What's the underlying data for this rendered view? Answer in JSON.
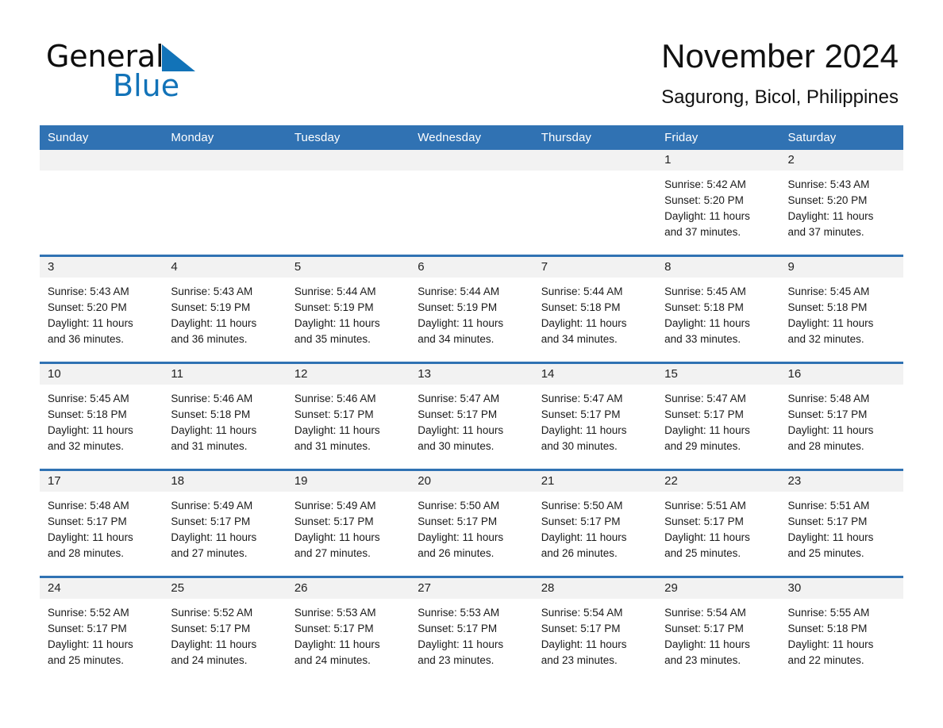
{
  "brand": {
    "name_part1": "General",
    "name_part2": "Blue",
    "accent_color": "#1273b8"
  },
  "header": {
    "title": "November 2024",
    "location": "Sagurong, Bicol, Philippines",
    "header_bg": "#3072b3",
    "daynum_bg": "#f2f2f2"
  },
  "weekdays": [
    "Sunday",
    "Monday",
    "Tuesday",
    "Wednesday",
    "Thursday",
    "Friday",
    "Saturday"
  ],
  "labels": {
    "sunrise": "Sunrise:",
    "sunset": "Sunset:",
    "daylight": "Daylight:"
  },
  "weeks": [
    [
      {
        "day": "",
        "empty": true
      },
      {
        "day": "",
        "empty": true
      },
      {
        "day": "",
        "empty": true
      },
      {
        "day": "",
        "empty": true
      },
      {
        "day": "",
        "empty": true
      },
      {
        "day": "1",
        "sunrise": "Sunrise: 5:42 AM",
        "sunset": "Sunset: 5:20 PM",
        "daylight_line1": "Daylight: 11 hours",
        "daylight_line2": "and 37 minutes."
      },
      {
        "day": "2",
        "sunrise": "Sunrise: 5:43 AM",
        "sunset": "Sunset: 5:20 PM",
        "daylight_line1": "Daylight: 11 hours",
        "daylight_line2": "and 37 minutes."
      }
    ],
    [
      {
        "day": "3",
        "sunrise": "Sunrise: 5:43 AM",
        "sunset": "Sunset: 5:20 PM",
        "daylight_line1": "Daylight: 11 hours",
        "daylight_line2": "and 36 minutes."
      },
      {
        "day": "4",
        "sunrise": "Sunrise: 5:43 AM",
        "sunset": "Sunset: 5:19 PM",
        "daylight_line1": "Daylight: 11 hours",
        "daylight_line2": "and 36 minutes."
      },
      {
        "day": "5",
        "sunrise": "Sunrise: 5:44 AM",
        "sunset": "Sunset: 5:19 PM",
        "daylight_line1": "Daylight: 11 hours",
        "daylight_line2": "and 35 minutes."
      },
      {
        "day": "6",
        "sunrise": "Sunrise: 5:44 AM",
        "sunset": "Sunset: 5:19 PM",
        "daylight_line1": "Daylight: 11 hours",
        "daylight_line2": "and 34 minutes."
      },
      {
        "day": "7",
        "sunrise": "Sunrise: 5:44 AM",
        "sunset": "Sunset: 5:18 PM",
        "daylight_line1": "Daylight: 11 hours",
        "daylight_line2": "and 34 minutes."
      },
      {
        "day": "8",
        "sunrise": "Sunrise: 5:45 AM",
        "sunset": "Sunset: 5:18 PM",
        "daylight_line1": "Daylight: 11 hours",
        "daylight_line2": "and 33 minutes."
      },
      {
        "day": "9",
        "sunrise": "Sunrise: 5:45 AM",
        "sunset": "Sunset: 5:18 PM",
        "daylight_line1": "Daylight: 11 hours",
        "daylight_line2": "and 32 minutes."
      }
    ],
    [
      {
        "day": "10",
        "sunrise": "Sunrise: 5:45 AM",
        "sunset": "Sunset: 5:18 PM",
        "daylight_line1": "Daylight: 11 hours",
        "daylight_line2": "and 32 minutes."
      },
      {
        "day": "11",
        "sunrise": "Sunrise: 5:46 AM",
        "sunset": "Sunset: 5:18 PM",
        "daylight_line1": "Daylight: 11 hours",
        "daylight_line2": "and 31 minutes."
      },
      {
        "day": "12",
        "sunrise": "Sunrise: 5:46 AM",
        "sunset": "Sunset: 5:17 PM",
        "daylight_line1": "Daylight: 11 hours",
        "daylight_line2": "and 31 minutes."
      },
      {
        "day": "13",
        "sunrise": "Sunrise: 5:47 AM",
        "sunset": "Sunset: 5:17 PM",
        "daylight_line1": "Daylight: 11 hours",
        "daylight_line2": "and 30 minutes."
      },
      {
        "day": "14",
        "sunrise": "Sunrise: 5:47 AM",
        "sunset": "Sunset: 5:17 PM",
        "daylight_line1": "Daylight: 11 hours",
        "daylight_line2": "and 30 minutes."
      },
      {
        "day": "15",
        "sunrise": "Sunrise: 5:47 AM",
        "sunset": "Sunset: 5:17 PM",
        "daylight_line1": "Daylight: 11 hours",
        "daylight_line2": "and 29 minutes."
      },
      {
        "day": "16",
        "sunrise": "Sunrise: 5:48 AM",
        "sunset": "Sunset: 5:17 PM",
        "daylight_line1": "Daylight: 11 hours",
        "daylight_line2": "and 28 minutes."
      }
    ],
    [
      {
        "day": "17",
        "sunrise": "Sunrise: 5:48 AM",
        "sunset": "Sunset: 5:17 PM",
        "daylight_line1": "Daylight: 11 hours",
        "daylight_line2": "and 28 minutes."
      },
      {
        "day": "18",
        "sunrise": "Sunrise: 5:49 AM",
        "sunset": "Sunset: 5:17 PM",
        "daylight_line1": "Daylight: 11 hours",
        "daylight_line2": "and 27 minutes."
      },
      {
        "day": "19",
        "sunrise": "Sunrise: 5:49 AM",
        "sunset": "Sunset: 5:17 PM",
        "daylight_line1": "Daylight: 11 hours",
        "daylight_line2": "and 27 minutes."
      },
      {
        "day": "20",
        "sunrise": "Sunrise: 5:50 AM",
        "sunset": "Sunset: 5:17 PM",
        "daylight_line1": "Daylight: 11 hours",
        "daylight_line2": "and 26 minutes."
      },
      {
        "day": "21",
        "sunrise": "Sunrise: 5:50 AM",
        "sunset": "Sunset: 5:17 PM",
        "daylight_line1": "Daylight: 11 hours",
        "daylight_line2": "and 26 minutes."
      },
      {
        "day": "22",
        "sunrise": "Sunrise: 5:51 AM",
        "sunset": "Sunset: 5:17 PM",
        "daylight_line1": "Daylight: 11 hours",
        "daylight_line2": "and 25 minutes."
      },
      {
        "day": "23",
        "sunrise": "Sunrise: 5:51 AM",
        "sunset": "Sunset: 5:17 PM",
        "daylight_line1": "Daylight: 11 hours",
        "daylight_line2": "and 25 minutes."
      }
    ],
    [
      {
        "day": "24",
        "sunrise": "Sunrise: 5:52 AM",
        "sunset": "Sunset: 5:17 PM",
        "daylight_line1": "Daylight: 11 hours",
        "daylight_line2": "and 25 minutes."
      },
      {
        "day": "25",
        "sunrise": "Sunrise: 5:52 AM",
        "sunset": "Sunset: 5:17 PM",
        "daylight_line1": "Daylight: 11 hours",
        "daylight_line2": "and 24 minutes."
      },
      {
        "day": "26",
        "sunrise": "Sunrise: 5:53 AM",
        "sunset": "Sunset: 5:17 PM",
        "daylight_line1": "Daylight: 11 hours",
        "daylight_line2": "and 24 minutes."
      },
      {
        "day": "27",
        "sunrise": "Sunrise: 5:53 AM",
        "sunset": "Sunset: 5:17 PM",
        "daylight_line1": "Daylight: 11 hours",
        "daylight_line2": "and 23 minutes."
      },
      {
        "day": "28",
        "sunrise": "Sunrise: 5:54 AM",
        "sunset": "Sunset: 5:17 PM",
        "daylight_line1": "Daylight: 11 hours",
        "daylight_line2": "and 23 minutes."
      },
      {
        "day": "29",
        "sunrise": "Sunrise: 5:54 AM",
        "sunset": "Sunset: 5:17 PM",
        "daylight_line1": "Daylight: 11 hours",
        "daylight_line2": "and 23 minutes."
      },
      {
        "day": "30",
        "sunrise": "Sunrise: 5:55 AM",
        "sunset": "Sunset: 5:18 PM",
        "daylight_line1": "Daylight: 11 hours",
        "daylight_line2": "and 22 minutes."
      }
    ]
  ]
}
